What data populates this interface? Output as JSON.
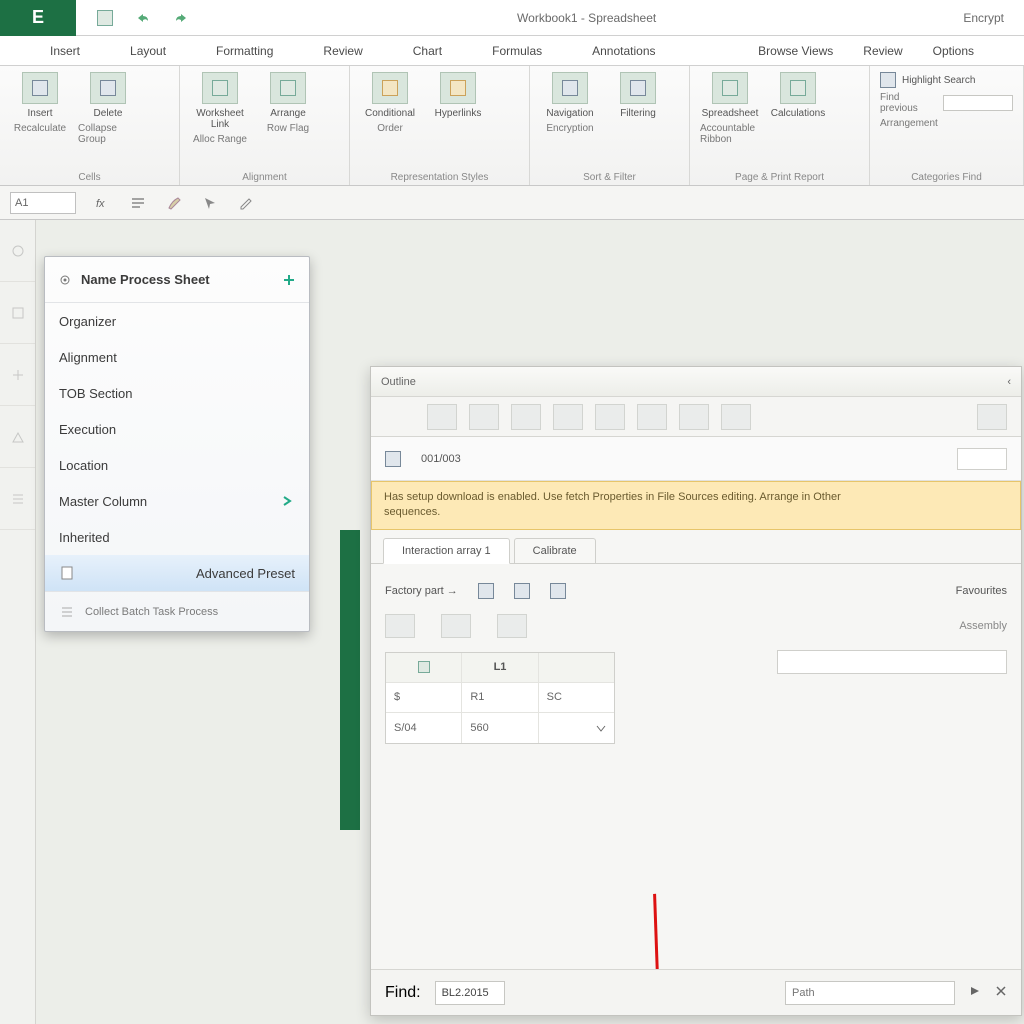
{
  "titlebar": {
    "app_letter": "E",
    "center_text": "Workbook1 - Spreadsheet",
    "right1": "Encrypt",
    "right2": "Review",
    "tabs_right1": "Browse  Views",
    "tabs_right3": "Options"
  },
  "tabs": {
    "t1": "Insert",
    "t2": "Layout",
    "t3": "Formatting",
    "t4": "Review",
    "t5": "Chart",
    "t6": "Formulas",
    "t7": "Annotations"
  },
  "ribbon": {
    "g1": {
      "big1": "Insert",
      "big2": "Delete",
      "sub1": "Recalculate",
      "sub2": "Collapse Group",
      "label": "Cells"
    },
    "g2": {
      "big1": "Worksheet Link",
      "big2": "Arrange",
      "sub1": "Alloc Range",
      "sub2": "Row Flag",
      "label": "Alignment"
    },
    "g3": {
      "big1": "Conditional",
      "big2": "Hyperlinks",
      "sub1": "Order",
      "label": "Representation  Styles"
    },
    "g4": {
      "big1": "Navigation",
      "big2": "Filtering",
      "sub1": "Encryption",
      "label": "Sort & Filter"
    },
    "g5": {
      "big1": "Spreadsheet",
      "big2": "Calculations",
      "sub1": "Accountable Ribbon",
      "label": "Page & Print   Report"
    },
    "g6": {
      "input_label": "Highlight Search",
      "sub1": "Find previous",
      "sub2": "Arrangement",
      "label": "Categories  Find"
    }
  },
  "formulabar": {
    "name": "A1"
  },
  "context_menu": {
    "header": "Name Process Sheet",
    "items": [
      {
        "label": "Organizer",
        "submenu": false
      },
      {
        "label": "Alignment",
        "submenu": false
      },
      {
        "label": "TOB Section",
        "submenu": false
      },
      {
        "label": "Execution",
        "submenu": false
      },
      {
        "label": "Location",
        "submenu": false
      },
      {
        "label": "Master Column",
        "submenu": true
      },
      {
        "label": "Inherited",
        "submenu": false
      },
      {
        "label": "Advanced  Preset",
        "submenu": false
      }
    ],
    "footer": "Collect  Batch Task Process"
  },
  "subwin": {
    "hdr1": "Outline",
    "hdr2": "001/003",
    "banner1": "Has setup download is enabled. Use fetch Properties in File Sources editing. Arrange in Other",
    "banner2": "sequences.",
    "tab1": "Interaction array 1",
    "tab2": "Calibrate",
    "section1": "Factory part →",
    "section2": "Favourites",
    "group_label": "Assembly",
    "grid_h1": "L1",
    "grid_h2": "R1",
    "grid_h3": "SC",
    "grid_a1": "S/04",
    "grid_a2": "560",
    "footer_label": "Find:",
    "footer_value": "BL2.2015",
    "search_placeholder": "Path"
  }
}
